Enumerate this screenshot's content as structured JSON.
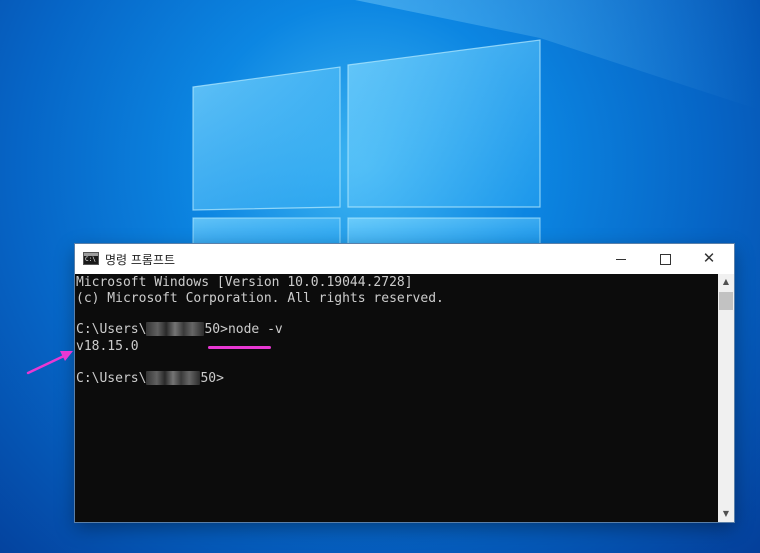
{
  "window": {
    "title": "명령 프롬프트",
    "icon_label": "C:\\",
    "icon": "terminal-icon",
    "controls": {
      "minimize": "minimize-icon",
      "maximize": "maximize-icon",
      "close": "✕"
    }
  },
  "console": {
    "lines": [
      "Microsoft Windows [Version 10.0.19044.2728]",
      "(c) Microsoft Corporation. All rights reserved."
    ],
    "prompt1_prefix": "C:\\Users\\",
    "prompt1_suffix": "50>",
    "command": "node -v",
    "output": "v18.15.0",
    "prompt2_prefix": "C:\\Users\\",
    "prompt2_suffix": "50>"
  },
  "scrollbar": {
    "up_glyph": "▲",
    "down_glyph": "▼"
  },
  "annotations": {
    "arrow_color": "#e838d3",
    "underline_color": "#e838d3"
  },
  "colors": {
    "console_bg": "#0c0c0c",
    "console_text": "#cccccc",
    "desktop_blue": "#0a78d7"
  }
}
